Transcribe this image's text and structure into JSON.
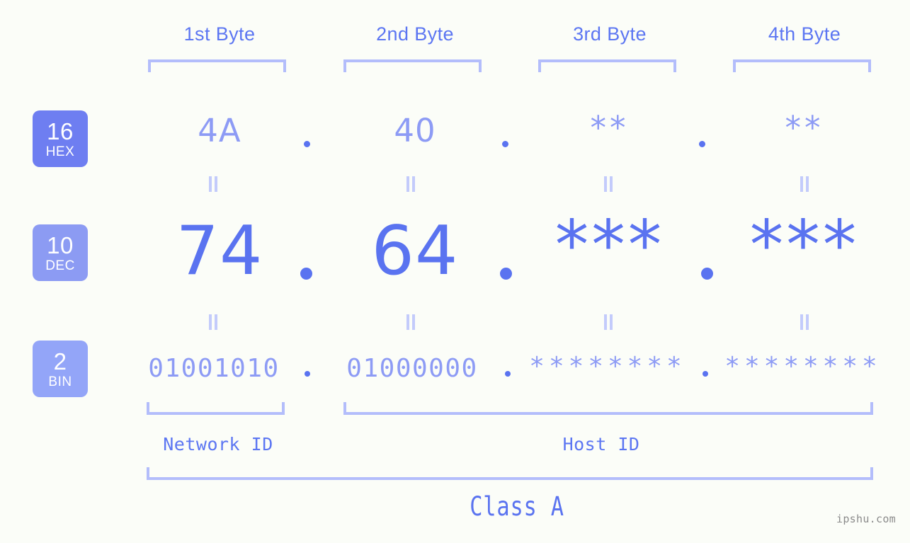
{
  "background_color": "#fbfdf8",
  "accent_strong": "#5a73f0",
  "accent_mid": "#8d9bf5",
  "accent_light": "#b3bdfb",
  "header": {
    "byte_labels": [
      {
        "label": "1st Byte"
      },
      {
        "label": "2nd Byte"
      },
      {
        "label": "3rd Byte"
      },
      {
        "label": "4th Byte"
      }
    ]
  },
  "rows": [
    {
      "base_number": "16",
      "base_name": "HEX",
      "badge_color": "#6e7ef1",
      "values": [
        "4A",
        "40",
        "**",
        "**"
      ]
    },
    {
      "base_number": "10",
      "base_name": "DEC",
      "badge_color": "#8c9bf3",
      "values": [
        "74",
        "64",
        "***",
        "***"
      ]
    },
    {
      "base_number": "2",
      "base_name": "BIN",
      "badge_color": "#93a5f8",
      "values": [
        "01001010",
        "01000000",
        "********",
        "********"
      ]
    }
  ],
  "separators": {
    "hex_dots": [
      ".",
      ".",
      "."
    ],
    "dec_dots": [
      ".",
      ".",
      "."
    ],
    "bin_dots": [
      ".",
      ".",
      "."
    ]
  },
  "equality_marks": {
    "glyph": "=",
    "count_per_gap": 4
  },
  "footer": {
    "network_id_label": "Network ID",
    "host_id_label": "Host ID",
    "class_label": "Class A"
  },
  "watermark": "ipshu.com"
}
